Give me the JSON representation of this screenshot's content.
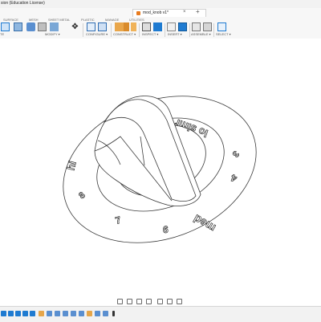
{
  "app": {
    "title": "sion (Education License)"
  },
  "document": {
    "tab_title": "mod_knob v1*",
    "close_glyph": "×",
    "new_tab_glyph": "+"
  },
  "workspace_tabs": [
    "SURFACE",
    "MESH",
    "SHEET METAL",
    "PLASTIC",
    "MANAGE",
    "UTILITIES"
  ],
  "toolbar_groups": [
    "MODIFY ▾",
    "CONFIGURE ▾",
    "CONSTRUCT ▾",
    "INSPECT ▾",
    "INSERT ▾",
    "ASSEMBLE ▾",
    "SELECT ▾"
  ],
  "toolbar_leading_fragment": "TE",
  "model": {
    "dial_labels": [
      "hi",
      "8",
      "7",
      "6",
      "med",
      "4",
      "3",
      "lo simr"
    ],
    "labels_original_render": {
      "hi": "hi",
      "8": "8",
      "7": "7",
      "6": "6",
      "med": "med",
      "4": "4",
      "3": "3",
      "lo_simr": "lo simr"
    }
  },
  "colors": {
    "accent": "#1f7bd1",
    "orange": "#e87b1e",
    "line": "#3a3a3a",
    "background": "#ffffff"
  },
  "icons": {
    "toolbar": [
      "box-icon",
      "push-pull-icon",
      "fillet-icon",
      "chamfer-icon",
      "shell-icon",
      "move-icon",
      "configure-table-icon",
      "configure-gear-icon",
      "offset-plane-icon",
      "axis-icon",
      "point-icon",
      "measure-icon",
      "interference-icon",
      "insert-derive-icon",
      "insert-image-icon",
      "joint-icon",
      "joint-origin-icon",
      "select-icon"
    ],
    "timeline": [
      "first-icon",
      "prev-icon",
      "play-icon",
      "next-icon",
      "last-icon"
    ]
  }
}
